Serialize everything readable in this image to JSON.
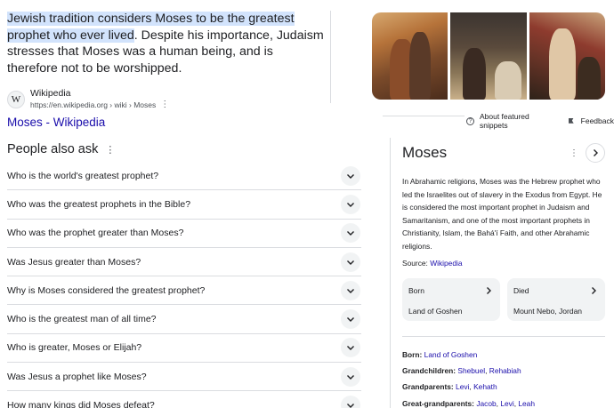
{
  "snippet": {
    "highlight": "Jewish tradition considers Moses to be the greatest prophet who ever lived",
    "rest": ". Despite his importance, Judaism stresses that Moses was a human being, and is therefore not to be worshipped.",
    "source_name": "Wikipedia",
    "source_url": "https://en.wikipedia.org › wiki › Moses",
    "logo_letter": "W",
    "link_title": "Moses - Wikipedia"
  },
  "feedback": {
    "about": "About featured snippets",
    "feedback": "Feedback"
  },
  "paa": {
    "title": "People also ask",
    "questions": [
      "Who is the world's greatest prophet?",
      "Who was the greatest prophets in the Bible?",
      "Who was the prophet greater than Moses?",
      "Was Jesus greater than Moses?",
      "Why is Moses considered the greatest prophet?",
      "Who is the greatest man of all time?",
      "Who is greater, Moses or Elijah?",
      "Was Jesus a prophet like Moses?",
      "How many kings did Moses defeat?"
    ]
  },
  "kp": {
    "title": "Moses",
    "description": "In Abrahamic religions, Moses was the Hebrew prophet who led the Israelites out of slavery in the Exodus from Egypt. He is considered the most important prophet in Judaism and Samaritanism, and one of the most important prophets in Christianity, Islam, the Bahá'í Faith, and other Abrahamic religions.",
    "source_label": "Source: ",
    "source_link": "Wikipedia",
    "cards": [
      {
        "label": "Born",
        "value": "Land of Goshen"
      },
      {
        "label": "Died",
        "value": "Mount Nebo, Jordan"
      }
    ],
    "facts": {
      "born_label": "Born: ",
      "born_value": "Land of Goshen",
      "grandchildren_label": "Grandchildren: ",
      "grandchildren_1": "Shebuel",
      "grandchildren_2": "Rehabiah",
      "grandparents_label": "Grandparents: ",
      "grandparents_1": "Levi",
      "grandparents_2": "Kehath",
      "great_label": "Great-grandparents: ",
      "great_1": "Jacob",
      "great_2": "Levi",
      "great_3": "Leah"
    }
  },
  "colors": {
    "link": "#1a0dab",
    "highlight": "#d2e3fc",
    "divider": "#dadce0"
  }
}
